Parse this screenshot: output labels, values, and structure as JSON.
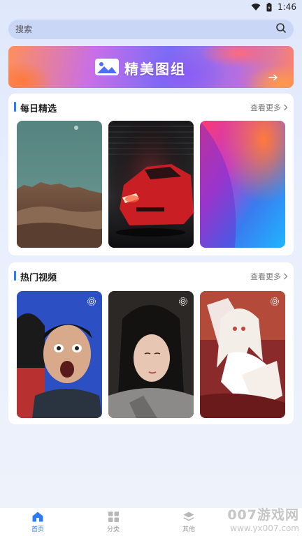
{
  "status_bar": {
    "time": "1:46"
  },
  "search": {
    "placeholder": "搜索"
  },
  "banner": {
    "title": "精美图组"
  },
  "daily": {
    "title": "每日精选",
    "more": "查看更多",
    "items": [
      "mountain-landscape",
      "red-sports-car",
      "gradient-abstract"
    ]
  },
  "hot_videos": {
    "title": "热门视频",
    "more": "查看更多",
    "items": [
      "surprised-man",
      "woman-portrait",
      "anime-girl"
    ]
  },
  "tabbar": {
    "items": [
      {
        "label": "首页",
        "icon": "home-icon",
        "active": true
      },
      {
        "label": "分类",
        "icon": "grid-icon",
        "active": false
      },
      {
        "label": "其他",
        "icon": "layers-icon",
        "active": false
      },
      {
        "label": "",
        "icon": "",
        "active": false
      }
    ]
  },
  "watermark": {
    "line1": "007游戏网",
    "line2": "www.yx007.com"
  },
  "colors": {
    "accent": "#2f7bf5",
    "background": "#e3ebfb",
    "search_bg": "#c9d6f6"
  }
}
